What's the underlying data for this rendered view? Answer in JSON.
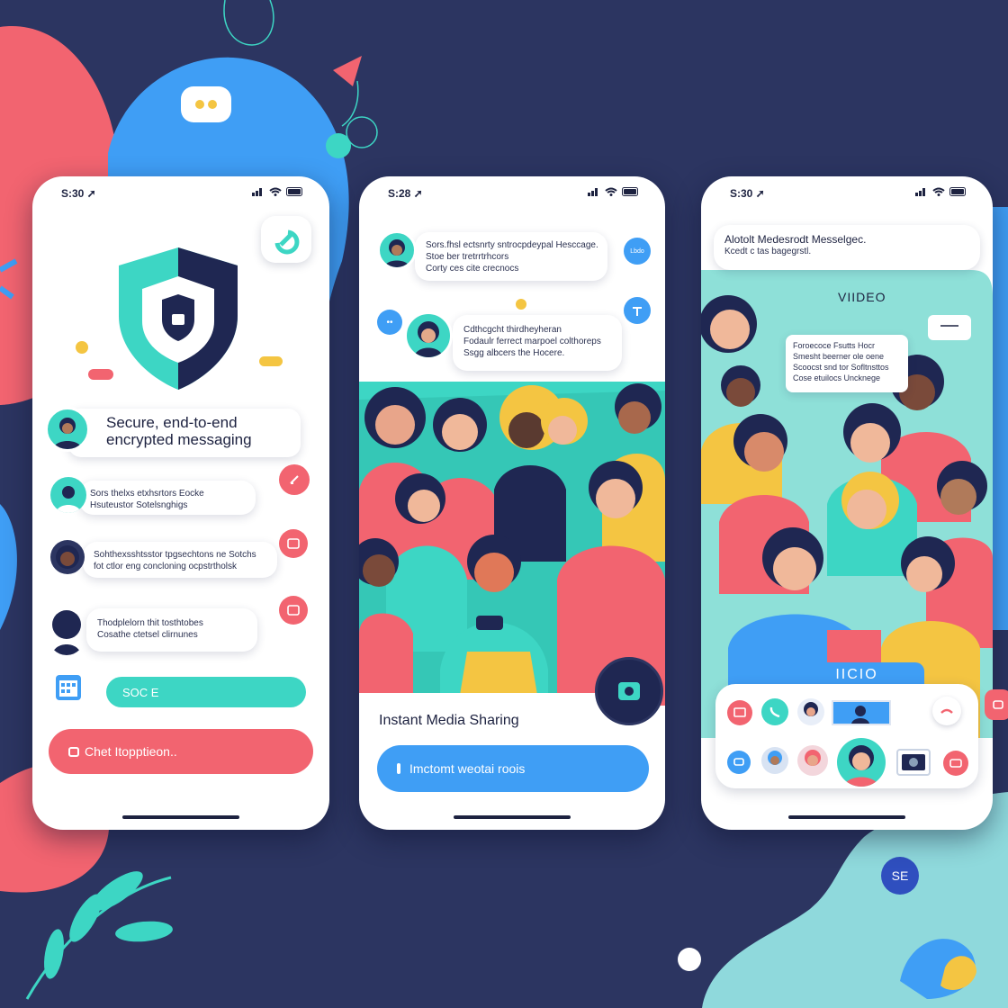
{
  "colors": {
    "background": "#2c3561",
    "teal": "#3dd6c4",
    "coral": "#f26470",
    "blue": "#3f9ef5",
    "navy": "#1f2752",
    "yellow": "#f4c542"
  },
  "phones": [
    {
      "status_time": "S:30 ➚",
      "security_title_line1": "Secure, end-to-end",
      "security_title_line2": "encrypted messaging",
      "messages": [
        {
          "line1": "Sors thelxs etxhsrtors Eocke",
          "line2": "Hsuteustor Sotelsnghigs"
        },
        {
          "line1": "Sohthexsshtsstor tpgsechtons ne Sotchs",
          "line2": "fot ctlor eng concloning ocpstrtholsk"
        },
        {
          "line1": "Thodplelorn thit tosthtobes",
          "line2": "Cosathe ctetsel clirnunes"
        }
      ],
      "teal_button_label": "SOC  E",
      "cta_label": "Chet Itopptieon.."
    },
    {
      "status_time": "S:28 ➚",
      "messages": [
        {
          "line1": "Sors.fhsl ectsnrty sntrocpdeypal Hesccage.",
          "line2": "Stoe ber tretrrtrhcors",
          "line3": "Corty ces cite crecnocs"
        },
        {
          "line1": "Cdthcgcht thirdheyheran",
          "line2": "Fodaulr ferrect marpoel colthoreps",
          "line3": "Ssgg albcers the Hocere."
        }
      ],
      "chip1_label": "Lbdo",
      "chip2_label": "••",
      "media_title": "Instant Media Sharing",
      "cta_label": "Imctomt weotai roois"
    },
    {
      "status_time": "S:30 ➚",
      "header_line1": "Alotolt Medesrodt Messelgec.",
      "header_line2": "Kcedt c tas bagegrstl.",
      "video_label": "VIIDEO",
      "info_line1": "Foroecoce Fsutts Hocr",
      "info_line2": "Smesht beerner ole oene",
      "info_line3": "Scoocst snd tor Sofltnsttos",
      "info_line4": "Cose etuilocs Uncknege",
      "tab_label": "IICIO"
    }
  ],
  "decor": {
    "bottom_badge": "SE"
  }
}
